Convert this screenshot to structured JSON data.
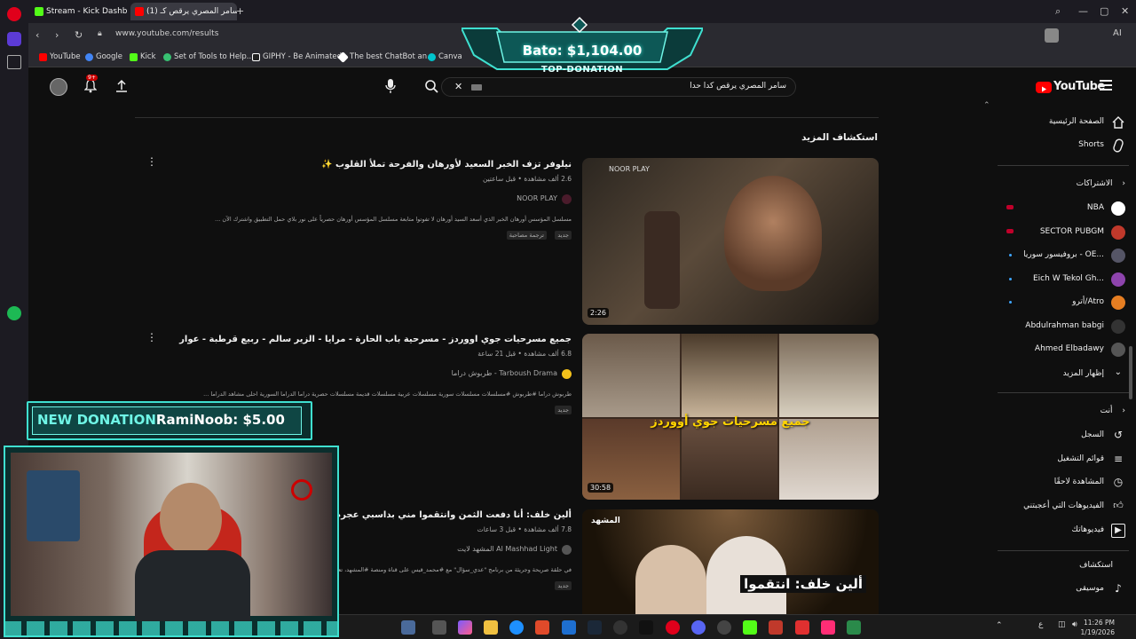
{
  "browser": {
    "tabs": [
      {
        "label": "Stream - Kick Dashboard",
        "favicon_color": "#53fc18"
      },
      {
        "label": "(1) سامر المصري يرقص كـ",
        "favicon_color": "#ff0000"
      }
    ],
    "url": "www.youtube.com/results",
    "bookmarks": [
      {
        "label": "YouTube",
        "color": "#ff0000"
      },
      {
        "label": "Google",
        "color": "#4285f4"
      },
      {
        "label": "Kick",
        "color": "#53fc18"
      },
      {
        "label": "Set of Tools to Help...",
        "color": "#38c172"
      },
      {
        "label": "GIPHY - Be Animated",
        "color": "#222222"
      },
      {
        "label": "The best ChatBot an...",
        "color": "#ffffff"
      },
      {
        "label": "Canva",
        "color": "#00c4cc"
      }
    ],
    "address_right_label": "AI"
  },
  "overlays": {
    "top_donation_amount": "Bato: $1,104.00",
    "top_donation_label": "TOP-DONATION",
    "new_donation_label": "NEW DONATION",
    "new_donation_text": "RamiNoob: $5.00"
  },
  "youtube": {
    "search_query": "سامر المصري يرقص كدا حدا",
    "logo_text": "YouTube",
    "notification_count": "9+",
    "section_title": "استكشاف المزيد",
    "videos": [
      {
        "title": "نيلوفر تزف الخبر السعيد لأورهان والفرحة تملأ القلوب ✨",
        "meta": "2.6 ألف مشاهدة • قبل ساعتين",
        "channel": "NOOR PLAY",
        "description": "مسلسل المؤسس أورهان الخبر الذي أسعد السيد أورهان لا تفوتوا متابعة مسلسل المؤسس أورهان حصرياً على نور بلاي حمل التطبيق واشترك الآن ...",
        "badges": [
          "جديد",
          "ترجمة مصاحبة"
        ],
        "duration": "2:26"
      },
      {
        "title": "جميع مسرحيات جوي اووردز - مسرحية باب الحارة - مرايا - الزير سالم - ربيع قرطبة - عوار",
        "meta": "6.8 ألف مشاهدة • قبل 21 ساعة",
        "channel": "طربوش دراما - Tarboush Drama",
        "description": "طربوش دراما #طربوش #مسلسلات مسلسلات سورية مسلسلات عربية مسلسلات قديمة مسلسلات حصرية دراما الدراما السورية احلى مشاهد الدراما ...",
        "badges": [
          "جديد"
        ],
        "duration": "30:58",
        "overlay_text": "جميع مسرحيات جوي أووردز"
      },
      {
        "title": "ألين خلف: أنا دفعت الثمن وانتقموا مني بداسبي عجرم - عدي سؤال",
        "meta": "7.8 ألف مشاهدة • قبل 3 ساعات",
        "channel": "المشهد لايت Al Mashhad Light",
        "description": "في حلقة صريحة وجريئة من برنامج \"عدي_سؤال\" مع #محمد_قيس على قناة ومنصة #المشهد، تعتبر ...",
        "badges": [
          "جديد"
        ],
        "duration": "",
        "overlay_text": "ألين خلف: انتقموا",
        "thumb_brand": "المشهد"
      }
    ],
    "sidebar": {
      "home": "الصفحة الرئيسية",
      "shorts": "Shorts",
      "subscriptions_header": "الاشتراكات",
      "subscriptions": [
        {
          "name": "NBA",
          "live": true,
          "avatar_color": "#ffffff"
        },
        {
          "name": "SECTOR PUBGM",
          "live": true,
          "avatar_color": "#c0392b"
        },
        {
          "name": "بروفيسور سوريا - OE...",
          "live": false,
          "dot": true,
          "avatar_color": "#556"
        },
        {
          "name": "Eich W Tekol Gh...",
          "live": false,
          "dot": true,
          "avatar_color": "#8e44ad"
        },
        {
          "name": "أترو/Atro",
          "live": false,
          "dot": true,
          "avatar_color": "#e67e22"
        },
        {
          "name": "Abdulrahman babgi",
          "live": false,
          "dot": false,
          "avatar_color": "#333"
        },
        {
          "name": "Ahmed Elbadawy",
          "live": false,
          "dot": false,
          "avatar_color": "#555"
        }
      ],
      "show_more": "إظهار المزيد",
      "you_header": "أنت",
      "you_items": [
        "السجل",
        "قوائم التشغيل",
        "المشاهدة لاحقًا",
        "الفيديوهات التي أعجبتني",
        "فيديوهاتك"
      ],
      "explore_header": "استكشاف",
      "explore_items": [
        "موسيقى"
      ]
    }
  },
  "taskbar": {
    "time": "11:26 PM",
    "date": "1/19/2026",
    "lang": "ع"
  }
}
